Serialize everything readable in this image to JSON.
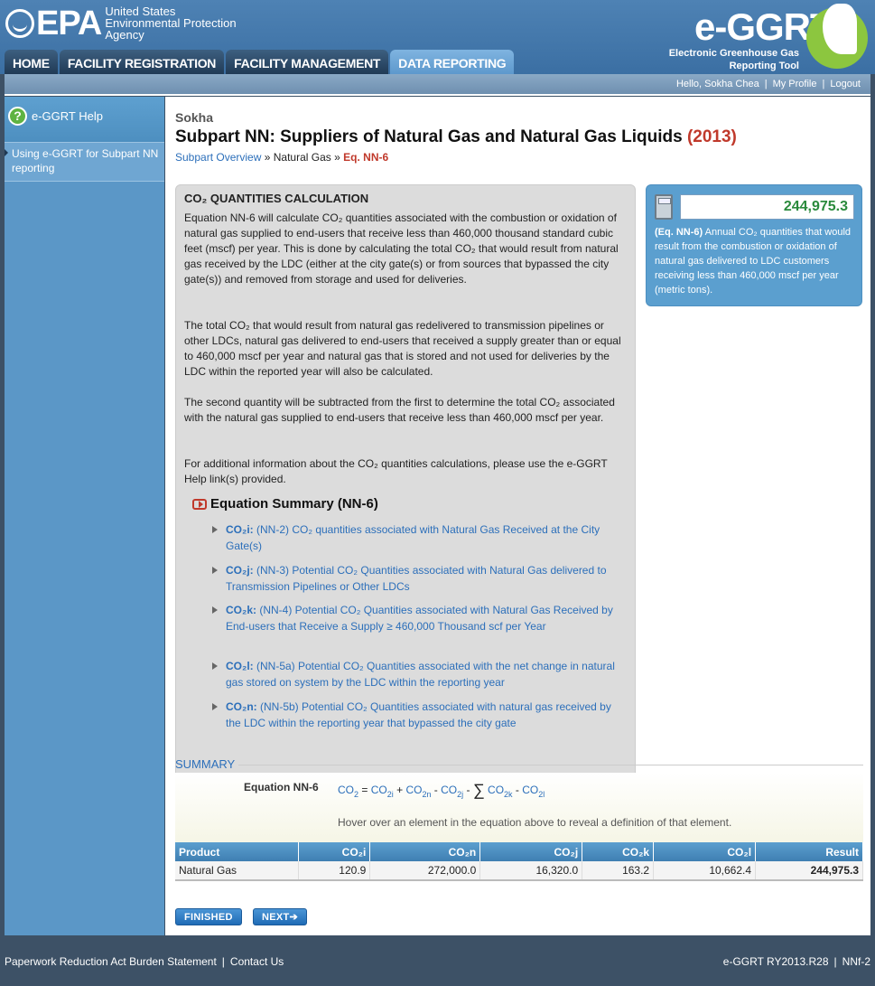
{
  "header": {
    "epa_word": "EPA",
    "epa_sub_1": "United States",
    "epa_sub_2": "Environmental Protection",
    "epa_sub_3": "Agency",
    "ggrt_logo": "e-GGRT",
    "ggrt_tag_1": "Electronic Greenhouse Gas",
    "ggrt_tag_2": "Reporting Tool"
  },
  "tabs": [
    "HOME",
    "FACILITY REGISTRATION",
    "FACILITY MANAGEMENT",
    "DATA REPORTING"
  ],
  "userbar": {
    "greeting": "Hello, Sokha Chea",
    "profile": "My Profile",
    "logout": "Logout",
    "sep": "|"
  },
  "sidebar": {
    "help": "e-GGRT Help",
    "link": "Using e-GGRT for Subpart NN reporting"
  },
  "page": {
    "facility": "Sokha",
    "title": "Subpart NN: Suppliers of Natural Gas and Natural Gas Liquids",
    "year": "(2013)",
    "crumb_1": "Subpart Overview",
    "crumb_sep": "»",
    "crumb_2": "Natural Gas",
    "crumb_3": "Eq. NN-6"
  },
  "calc": {
    "heading": "CO₂ QUANTITIES CALCULATION",
    "p1": "Equation NN-6 will calculate CO₂ quantities associated with the combustion or oxidation of natural gas supplied to end-users that receive less than 460,000 thousand standard cubic feet (mscf) per year. This is done by calculating the total CO₂ that would result from natural gas received by the LDC (either at the city gate(s) or from sources that bypassed the city gate(s)) and removed from storage and used for deliveries.",
    "p2": "The total CO₂ that would result from natural gas redelivered to transmission pipelines or other LDCs, natural gas delivered to end-users that received a supply greater than or equal to 460,000 mscf per year and natural gas that is stored and not used for deliveries by the LDC within the reported year will also be calculated.",
    "p3": "The second quantity will be subtracted from the first to determine the total CO₂ associated with the natural gas supplied to end-users that receive less than 460,000 mscf per year.",
    "p4": "For additional information about the CO₂ quantities calculations, please use the e-GGRT Help link(s) provided.",
    "eq_summary": "Equation Summary (NN-6)",
    "items": [
      {
        "code": "CO₂i:",
        "text": " (NN-2) CO₂ quantities associated with Natural Gas Received at the City Gate(s)"
      },
      {
        "code": "CO₂j:",
        "text": " (NN-3) Potential CO₂ Quantities associated with Natural Gas delivered to Transmission Pipelines or Other LDCs"
      },
      {
        "code": "CO₂k:",
        "text": " (NN-4) Potential CO₂ Quantities associated with Natural Gas Received by End-users that Receive a Supply ≥ 460,000 Thousand scf per Year"
      },
      {
        "code": "CO₂l:",
        "text": " (NN-5a) Potential CO₂ Quantities associated with the net change in natural gas stored on system by the LDC within the reporting year"
      },
      {
        "code": "CO₂n:",
        "text": " (NN-5b) Potential CO₂ Quantities associated with natural gas received by the LDC within the reporting year that bypassed the city gate"
      }
    ]
  },
  "result": {
    "value": "244,975.3",
    "eq": "(Eq. NN-6)",
    "desc": " Annual CO₂ quantities that would result from the combustion or oxidation of natural gas delivered to LDC customers receiving less than 460,000 mscf per year (metric tons)."
  },
  "summary": {
    "label": "SUMMARY",
    "eq_label": "Equation NN-6",
    "hover": "Hover over an element in the equation above to reveal a definition of that element.",
    "eq": {
      "co2": "CO",
      "s2": "2",
      "eqs": "=",
      "plus": "+",
      "minus": "-",
      "sigma": "∑",
      "i": "2i",
      "n": "2n",
      "j": "2j",
      "k": "2k",
      "l": "2l"
    }
  },
  "table": {
    "headers": [
      "Product",
      "CO₂i",
      "CO₂n",
      "CO₂j",
      "CO₂k",
      "CO₂l",
      "Result"
    ],
    "row": [
      "Natural Gas",
      "120.9",
      "272,000.0",
      "16,320.0",
      "163.2",
      "10,662.4",
      "244,975.3"
    ]
  },
  "buttons": {
    "finished": "FINISHED",
    "next": "NEXT➔"
  },
  "footer": {
    "paperwork": "Paperwork Reduction Act Burden Statement",
    "contact": "Contact Us",
    "sep": "|",
    "version": "e-GGRT RY2013.R28",
    "code": "NNf-2"
  },
  "colors": {
    "accent": "#2c6fba",
    "year": "#c0392b",
    "result": "#2a8a3c"
  }
}
